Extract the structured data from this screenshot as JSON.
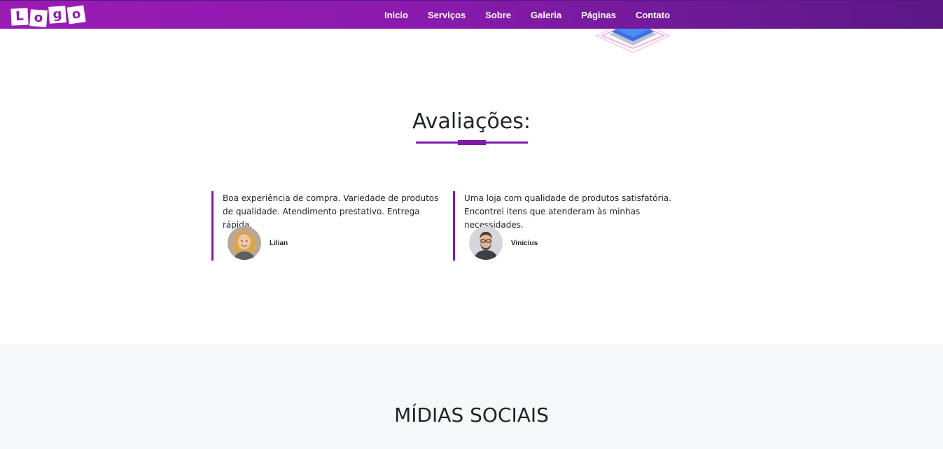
{
  "navbar": {
    "logo_letters": [
      "L",
      "o",
      "g",
      "o"
    ],
    "links": [
      "Inicio",
      "Serviços",
      "Sobre",
      "Galeria",
      "Páginas",
      "Contato"
    ]
  },
  "reviews_section": {
    "title": "Avaliações:",
    "reviews": [
      {
        "text": "Boa experiência de compra. Variedade de produtos de qualidade. Atendimento prestativo. Entrega rápida.",
        "name": "Lilian",
        "avatar_icon": "woman-avatar-photo"
      },
      {
        "text": "Uma loja com qualidade de produtos satisfatória. Encontrei itens que atenderam às minhas necessidades.",
        "name": "Vinicius",
        "avatar_icon": "man-avatar-photo"
      }
    ]
  },
  "social_section": {
    "title": "MÍDIAS SOCIAIS"
  },
  "colors": {
    "brand_purple": "#7e1aa7",
    "nav_gradient_start": "#9b1bb5",
    "nav_gradient_end": "#5c1786",
    "social_bg": "#f7f8fa"
  }
}
